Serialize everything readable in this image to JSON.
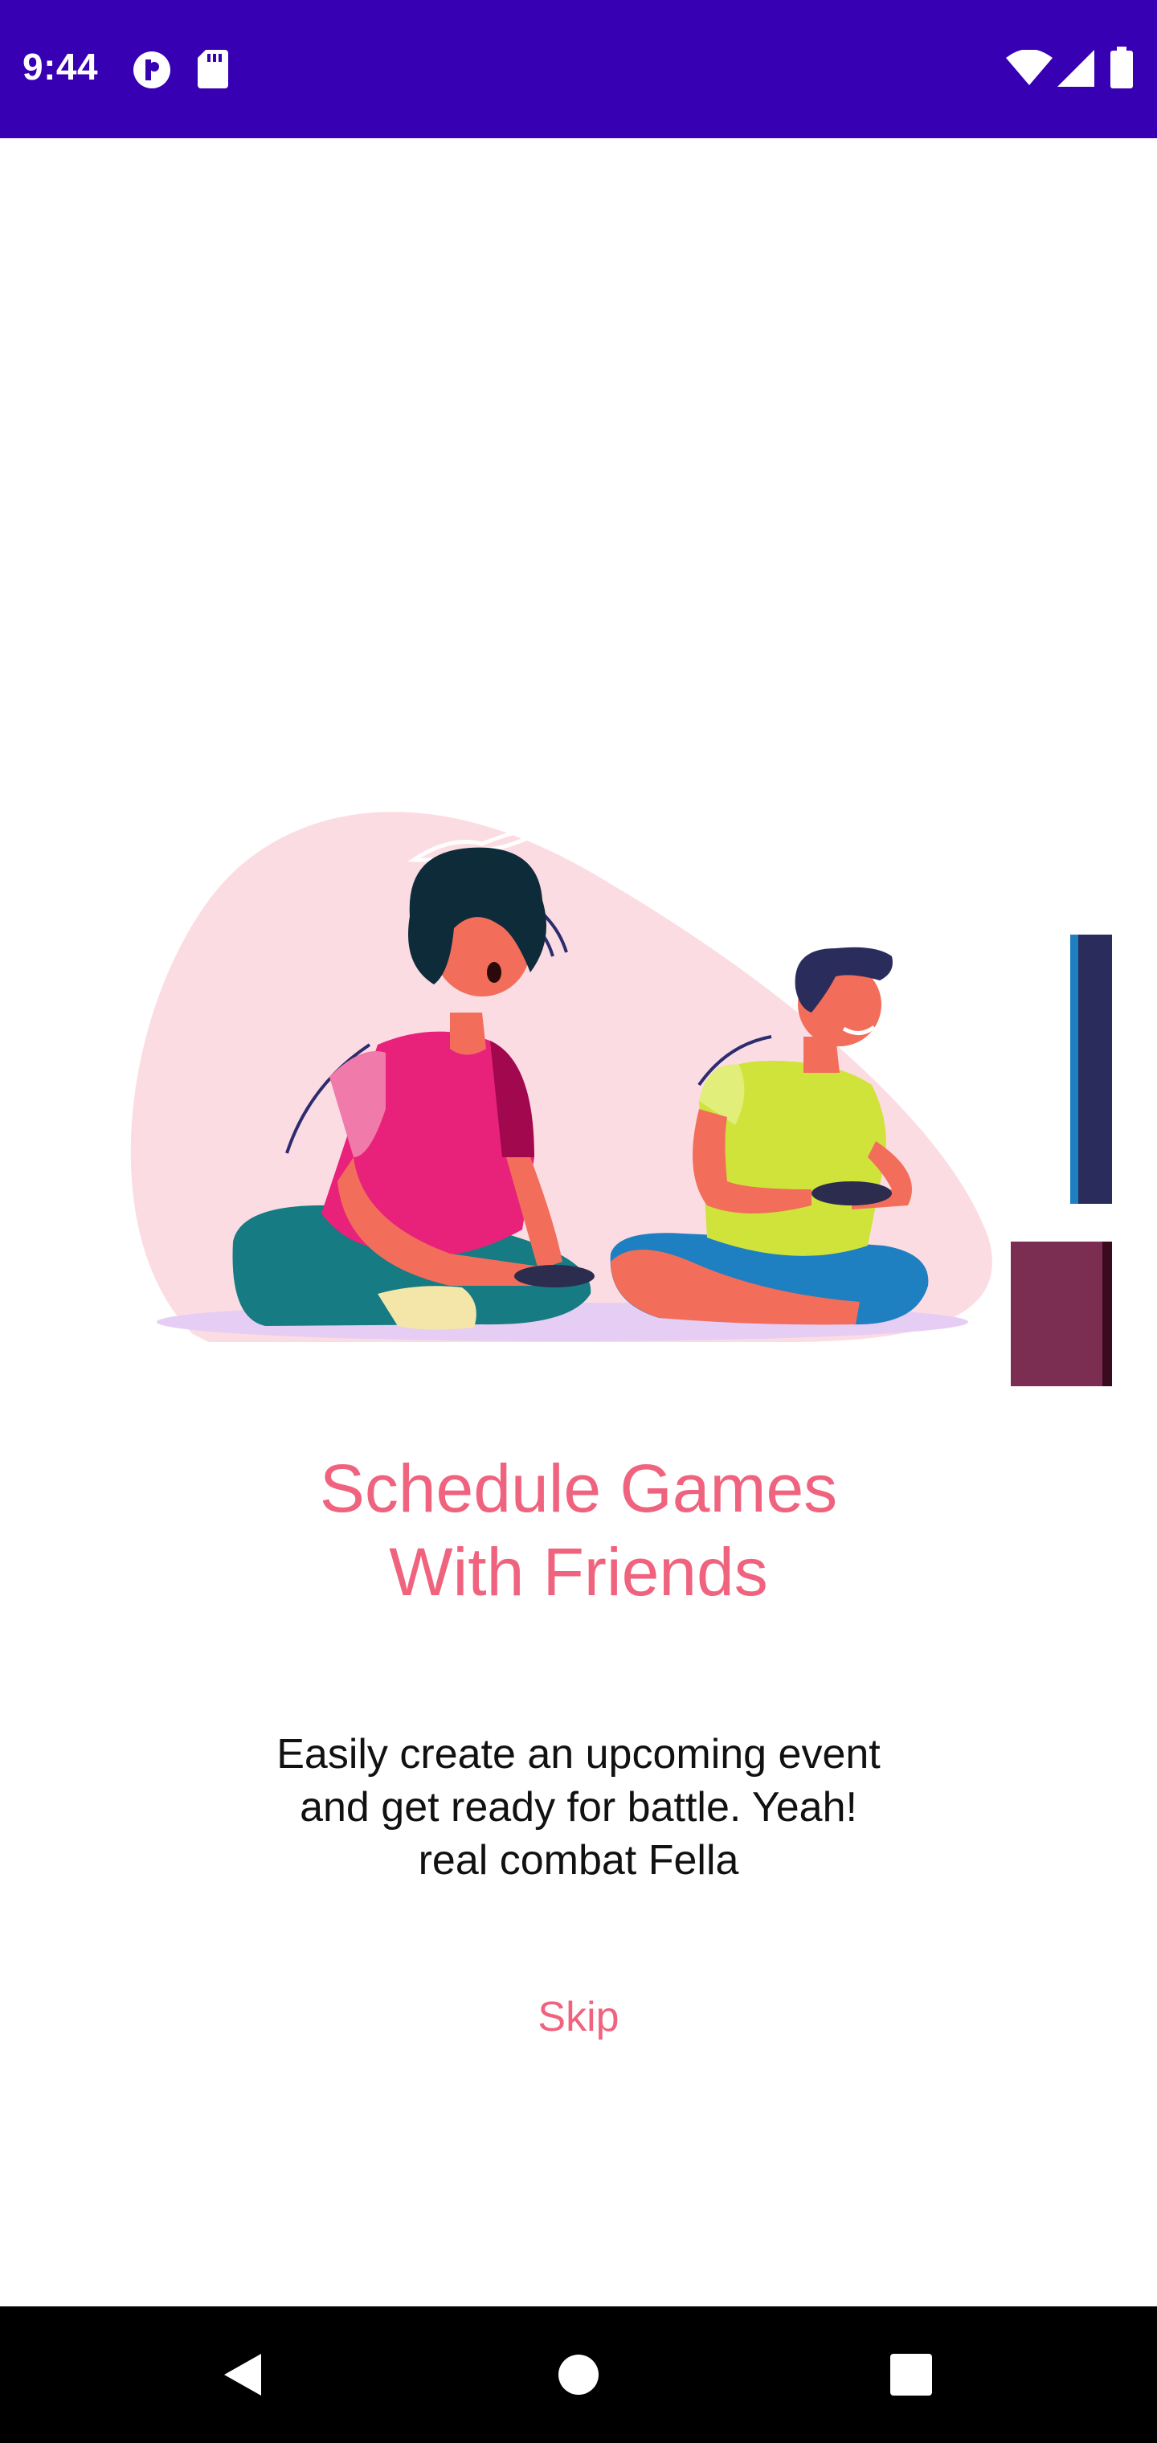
{
  "status_bar": {
    "time": "9:44",
    "background": "#3700b3",
    "left_icons": [
      "opera-icon",
      "sd-card-icon"
    ],
    "right_icons": [
      "wifi-icon",
      "cell-signal-icon",
      "battery-icon"
    ]
  },
  "onboarding": {
    "title_lines": [
      "Schedule Games",
      "With Friends"
    ],
    "description_lines": [
      "Easily create an upcoming event",
      "and get ready for battle. Yeah!",
      "real combat Fella"
    ],
    "skip_label": "Skip",
    "accent_color": "#f0637e"
  },
  "nav_bar": {
    "buttons": [
      "back-icon",
      "home-icon",
      "recents-icon"
    ]
  }
}
